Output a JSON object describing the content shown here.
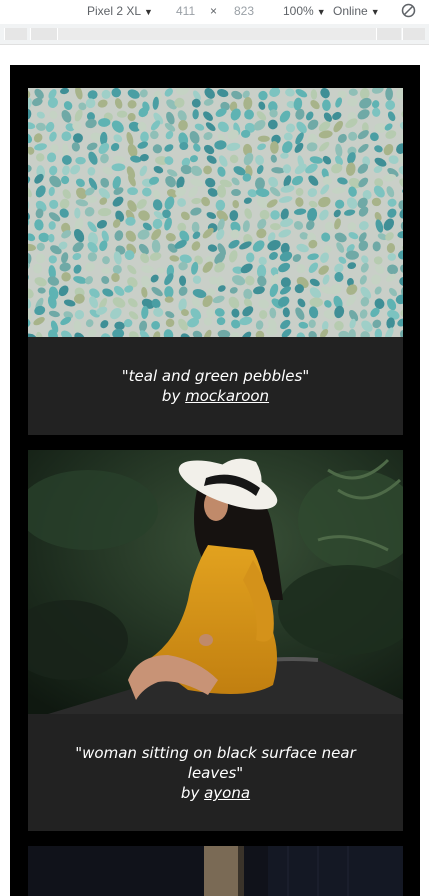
{
  "devtools": {
    "device": "Pixel 2 XL",
    "width": "411",
    "times": "×",
    "height": "823",
    "zoom": "100%",
    "network": "Online"
  },
  "cards": [
    {
      "quote": "\"teal and green pebbles\"",
      "by": "by",
      "author": "mockaroon"
    },
    {
      "quote": "\"woman sitting on black surface near leaves\"",
      "by": "by",
      "author": "ayona"
    }
  ]
}
